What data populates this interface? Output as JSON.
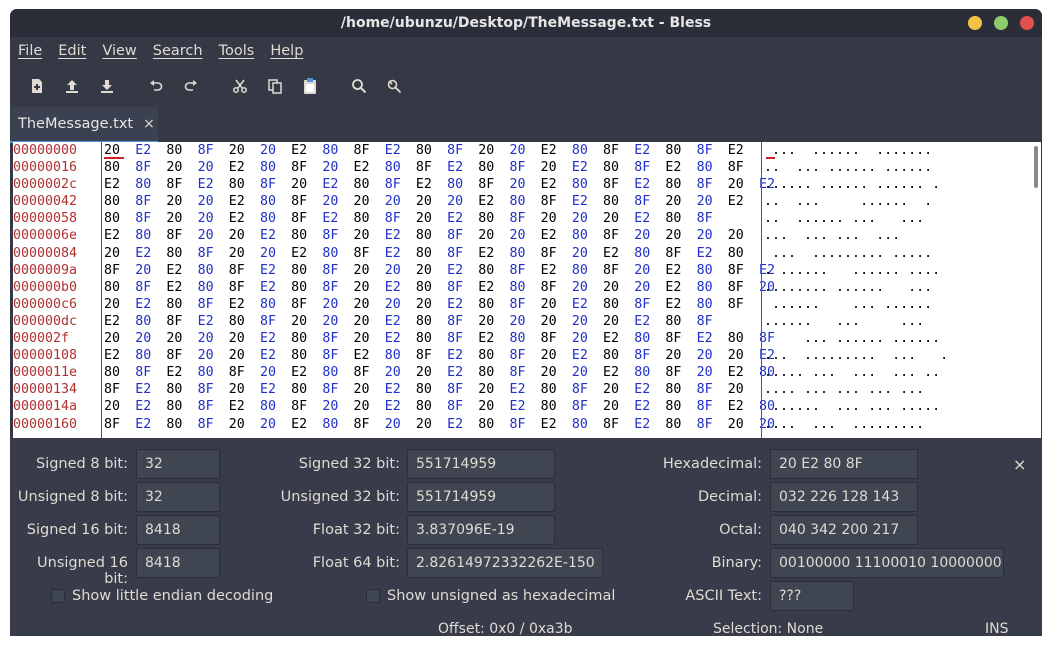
{
  "window": {
    "title": "/home/ubunzu/Desktop/TheMessage.txt - Bless"
  },
  "menu": [
    "File",
    "Edit",
    "View",
    "Search",
    "Tools",
    "Help"
  ],
  "toolbar": {
    "icons": [
      "new-file-icon",
      "upload-icon",
      "download-icon",
      "undo-icon",
      "redo-icon",
      "cut-icon",
      "copy-icon",
      "paste-icon",
      "find-icon",
      "replace-icon"
    ]
  },
  "tab": {
    "label": "TheMessage.txt",
    "close": "×"
  },
  "hex": {
    "rows": [
      {
        "offset": "00000000",
        "bytes": "20 E2 80 8F 20 20 E2 80 8F E2 80 8F 20 20 E2 80 8F E2 80 8F E2",
        "ascii": " ...  ......  ......."
      },
      {
        "offset": "00000016",
        "bytes": "80 8F 20 20 E2 80 8F 20 E2 80 8F E2 80 8F 20 E2 80 8F E2 80 8F",
        "ascii": "..  ... ...... ......"
      },
      {
        "offset": "0000002c",
        "bytes": "E2 80 8F E2 80 8F 20 E2 80 8F E2 80 8F 20 E2 80 8F E2 80 8F 20 E2",
        "ascii": "...... ...... ...... ."
      },
      {
        "offset": "00000042",
        "bytes": "80 8F 20 20 E2 80 8F 20 20 20 20 20 E2 80 8F E2 80 8F 20 20 E2",
        "ascii": "..  ...     ......  ."
      },
      {
        "offset": "00000058",
        "bytes": "80 8F 20 20 E2 80 8F E2 80 8F 20 E2 80 8F 20 20 20 E2 80 8F",
        "ascii": "..  ...... ...   ..."
      },
      {
        "offset": "0000006e",
        "bytes": "E2 80 8F 20 20 E2 80 8F 20 E2 80 8F 20 20 E2 80 8F 20 20 20 20",
        "ascii": "...  ... ...  ...    "
      },
      {
        "offset": "00000084",
        "bytes": "20 E2 80 8F 20 20 E2 80 8F E2 80 8F E2 80 8F 20 E2 80 8F E2 80",
        "ascii": " ...  ......... ....."
      },
      {
        "offset": "0000009a",
        "bytes": "8F 20 E2 80 8F E2 80 8F 20 20 20 E2 80 8F E2 80 8F 20 E2 80 8F E2",
        "ascii": ". ......   ...... ...."
      },
      {
        "offset": "000000b0",
        "bytes": "80 8F E2 80 8F E2 80 8F 20 E2 80 8F E2 80 8F 20 20 20 E2 80 8F 20",
        "ascii": "........ ......   ... "
      },
      {
        "offset": "000000c6",
        "bytes": "20 E2 80 8F E2 80 8F 20 20 20 20 E2 80 8F 20 E2 80 8F E2 80 8F",
        "ascii": " ......    ... ......"
      },
      {
        "offset": "000000dc",
        "bytes": "E2 80 8F E2 80 8F 20 20 20 E2 80 8F 20 20 20 20 20 E2 80 8F",
        "ascii": "......   ...     ..."
      },
      {
        "offset": "000002f",
        "bytes": "20 20 20 20 20 E2 80 8F 20 E2 80 8F E2 80 8F 20 E2 80 8F E2 80 8F",
        "ascii": "     ... ...... ......"
      },
      {
        "offset": "00000108",
        "bytes": "E2 80 8F 20 20 E2 80 8F E2 80 8F E2 80 8F 20 E2 80 8F 20 20 20 E2",
        "ascii": "...  .........  ...   ."
      },
      {
        "offset": "0000011e",
        "bytes": "80 8F E2 80 8F 20 E2 80 8F 20 20 E2 80 8F 20 20 E2 80 8F 20 E2 80",
        "ascii": "..... ...  ...  ... .."
      },
      {
        "offset": "00000134",
        "bytes": "8F E2 80 8F 20 E2 80 8F 20 E2 80 8F 20 E2 80 8F 20 E2 80 8F 20",
        "ascii": ".... ... ... ... ... "
      },
      {
        "offset": "0000014a",
        "bytes": "20 E2 80 8F E2 80 8F 20 20 E2 80 8F 20 E2 80 8F 20 E2 80 8F E2 80",
        "ascii": " ......  ... ... ....."
      },
      {
        "offset": "00000160",
        "bytes": "8F E2 80 8F 20 20 E2 80 8F 20 20 E2 80 8F E2 80 8F E2 80 8F 20 20",
        "ascii": "....  ...  .........  "
      }
    ]
  },
  "conversion": {
    "signed8_label": "Signed 8 bit:",
    "signed8": "32",
    "unsigned8_label": "Unsigned 8 bit:",
    "unsigned8": "32",
    "signed16_label": "Signed 16 bit:",
    "signed16": "8418",
    "unsigned16_label": "Unsigned 16 bit:",
    "unsigned16": "8418",
    "signed32_label": "Signed 32 bit:",
    "signed32": "551714959",
    "unsigned32_label": "Unsigned 32 bit:",
    "unsigned32": "551714959",
    "float32_label": "Float 32 bit:",
    "float32": "3.837096E-19",
    "float64_label": "Float 64 bit:",
    "float64": "2.82614972332262E-150",
    "hex_label": "Hexadecimal:",
    "hex": "20 E2 80 8F",
    "dec_label": "Decimal:",
    "dec": "032 226 128 143",
    "oct_label": "Octal:",
    "oct": "040 342 200 217",
    "bin_label": "Binary:",
    "bin": "00100000 11100010 10000000 10001111",
    "ascii_label": "ASCII Text:",
    "ascii": "???",
    "little_endian_label": "Show little endian decoding",
    "unsigned_hex_label": "Show unsigned as hexadecimal",
    "close": "×"
  },
  "status": {
    "offset": "Offset: 0x0 / 0xa3b",
    "selection": "Selection: None",
    "mode": "INS"
  }
}
